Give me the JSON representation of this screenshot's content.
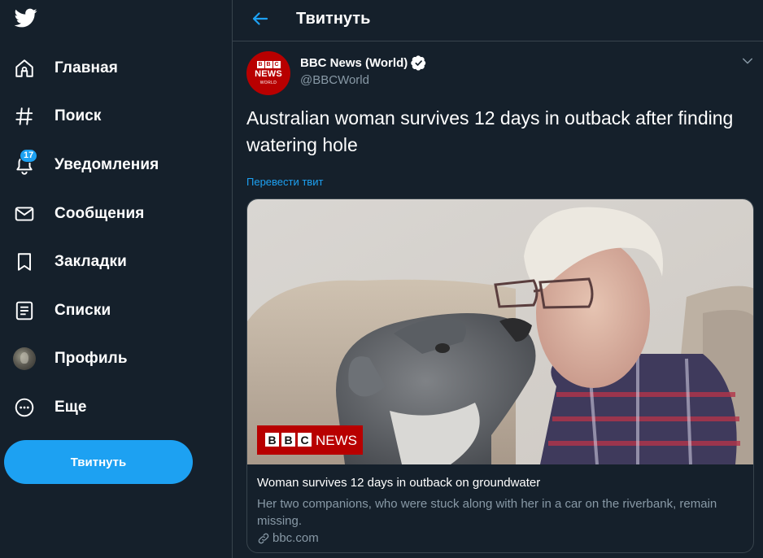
{
  "sidebar": {
    "logo_icon": "twitter-bird-icon",
    "items": [
      {
        "label": "Главная",
        "icon": "home-icon"
      },
      {
        "label": "Поиск",
        "icon": "hashtag-icon"
      },
      {
        "label": "Уведомления",
        "icon": "bell-icon",
        "badge": "17"
      },
      {
        "label": "Сообщения",
        "icon": "envelope-icon"
      },
      {
        "label": "Закладки",
        "icon": "bookmark-icon"
      },
      {
        "label": "Списки",
        "icon": "list-icon"
      },
      {
        "label": "Профиль",
        "icon": "avatar"
      },
      {
        "label": "Еще",
        "icon": "more-circle-icon"
      }
    ],
    "tweet_button": "Твитнуть"
  },
  "header": {
    "title": "Твитнуть",
    "back_icon": "back-arrow-icon"
  },
  "tweet": {
    "author_name": "BBC News (World)",
    "author_handle": "@BBCWorld",
    "avatar_text": {
      "block1": "B",
      "block2": "B",
      "block3": "C",
      "news": "NEWS",
      "world": "WORLD"
    },
    "text": "Australian woman survives 12 days in outback after finding watering hole",
    "translate_label": "Перевести твит",
    "card": {
      "image_badge": {
        "blocks": [
          "B",
          "B",
          "C"
        ],
        "news": "NEWS"
      },
      "title": "Woman survives 12 days in outback on groundwater",
      "description": "Her two companions, who were stuck along with her in a car on the riverbank, remain missing.",
      "domain": "bbc.com"
    }
  },
  "colors": {
    "background": "#15202b",
    "border": "#38444d",
    "accent": "#1da1f2",
    "secondary_text": "#8899a6",
    "bbc_red": "#b80000"
  }
}
